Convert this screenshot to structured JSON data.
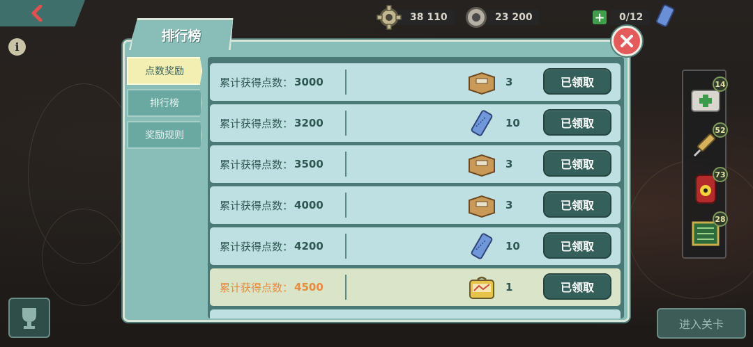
{
  "top_bar": {
    "gear_amount": "38 110",
    "caps_amount": "23 200",
    "slots": "0/12"
  },
  "panel": {
    "title": "排行榜",
    "tabs": [
      {
        "label": "点数奖励",
        "active": true
      },
      {
        "label": "排行榜",
        "active": false
      },
      {
        "label": "奖励规则",
        "active": false
      }
    ]
  },
  "rewards": [
    {
      "label": "累计获得点数：",
      "points": "3000",
      "icon": "crate-icon",
      "count": "3",
      "button": "已领取"
    },
    {
      "label": "累计获得点数：",
      "points": "3200",
      "icon": "ticket-icon",
      "count": "10",
      "button": "已领取"
    },
    {
      "label": "累计获得点数：",
      "points": "3500",
      "icon": "crate-icon",
      "count": "3",
      "button": "已领取"
    },
    {
      "label": "累计获得点数：",
      "points": "4000",
      "icon": "crate-icon",
      "count": "3",
      "button": "已领取"
    },
    {
      "label": "累计获得点数：",
      "points": "4200",
      "icon": "ticket-icon",
      "count": "10",
      "button": "已领取"
    },
    {
      "label": "累计获得点数：",
      "points": "4500",
      "icon": "lunchbox-icon",
      "count": "1",
      "button": "已领取",
      "highlight": true
    }
  ],
  "side_items": [
    {
      "name": "medkit-icon",
      "count": "14"
    },
    {
      "name": "syringe-icon",
      "count": "52"
    },
    {
      "name": "radaway-icon",
      "count": "73"
    },
    {
      "name": "map-kit-icon",
      "count": "28"
    }
  ],
  "bottom": {
    "enter_label": "进入关卡"
  },
  "colors": {
    "panel": "#89bdb8",
    "row": "#bfe0e2",
    "row_highlight": "#d9e4c8",
    "button": "#345f5a",
    "close": "#e35b5b",
    "active_tab": "#f3efb2"
  }
}
